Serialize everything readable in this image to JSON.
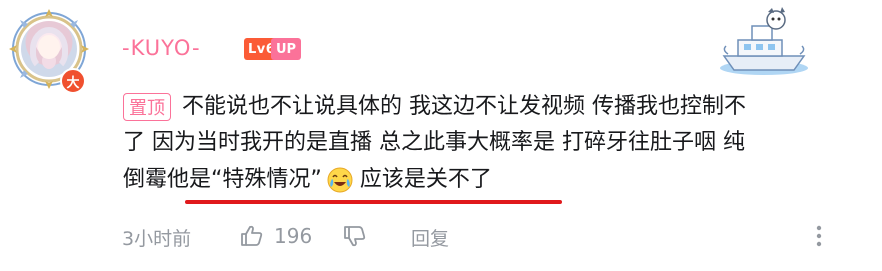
{
  "user": {
    "name": "-KUYO-",
    "avatar_badge": "大",
    "level_badge": "Lv6",
    "up_badge": "UP"
  },
  "comment": {
    "pin_tag": "置顶",
    "line1": "不能说也不让说具体的 我这边不让发视频 传播我也控制不",
    "line2": "了 因为当时我开的是直播 总之此事大概率是 打碎牙往肚子咽 纯",
    "line3_a": "倒霉 ",
    "line3_b": "他是“特殊情况”",
    "line3_c": " 应该是关不了",
    "emoji_icon": "laugh-cry-emoji-icon",
    "highlight_color": "#e0191c"
  },
  "footer": {
    "time": "3小时前",
    "like_count": "196",
    "reply_label": "回复"
  },
  "colors": {
    "username": "#fb7299",
    "level_badge": "#fb5b36",
    "up_badge": "#fb7299",
    "meta_text": "#9499a0"
  }
}
